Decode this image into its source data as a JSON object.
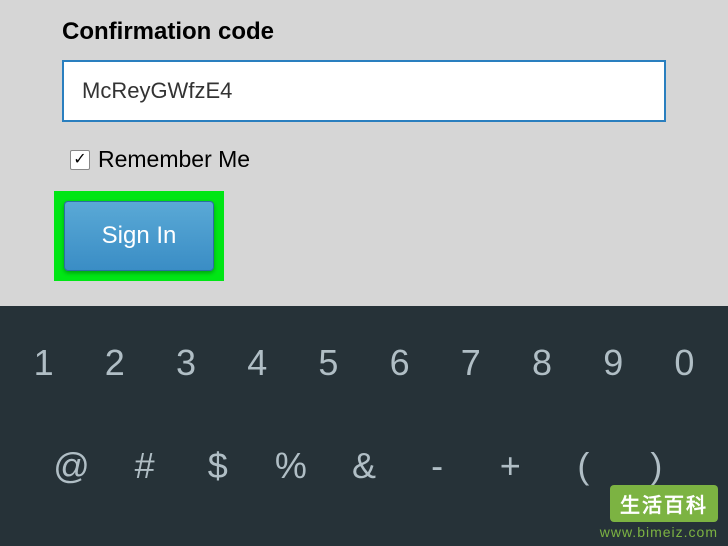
{
  "form": {
    "label": "Confirmation code",
    "code_value": "McReyGWfzE4",
    "remember_label": "Remember Me",
    "remember_checked": true,
    "signin_label": "Sign In"
  },
  "keyboard": {
    "row1": [
      "1",
      "2",
      "3",
      "4",
      "5",
      "6",
      "7",
      "8",
      "9",
      "0"
    ],
    "row2": [
      "@",
      "#",
      "$",
      "%",
      "&",
      "-",
      "+",
      "(",
      ")"
    ]
  },
  "watermark": {
    "badge": "生活百科",
    "url": "www.bimeiz.com"
  }
}
